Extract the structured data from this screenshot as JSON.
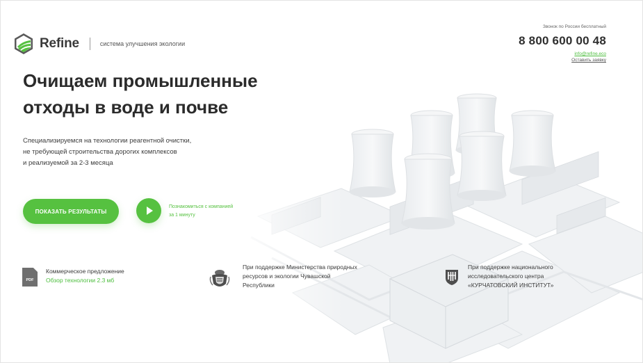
{
  "header": {
    "brand": "Refine",
    "tagline": "система улучшения экологии",
    "contacts": {
      "free_call_label": "Звонок по России бесплатный",
      "phone": "8 800 600 00 48",
      "email": "info@refine.eco",
      "request_link": "Оставить заявку"
    }
  },
  "hero": {
    "title_line1": "Очищаем промышленные",
    "title_line2": "отходы в воде и почве",
    "desc_line1": "Специализируемся на технологии реагентной очистки,",
    "desc_line2": "не требующей строительства дорогих комплексов",
    "desc_line3": "и реализуемой за 2-3 месяца",
    "cta_label": "ПОКАЗАТЬ РЕЗУЛЬТАТЫ",
    "video_line1": "Познакомиться с компанией",
    "video_line2": "за 1 минуту"
  },
  "features": {
    "pdf_badge": "PDF",
    "pdf_title": "Коммерческое предложение",
    "pdf_link": "Обзор технологии 2.3 мб",
    "support1_line1": "При поддержке Министерства природных",
    "support1_line2": "ресурсов и экологии Чувашской",
    "support1_line3": "Республики",
    "support2_line1": "При поддержке национального",
    "support2_line2": "исследовательского центра",
    "support2_line3": "«КУРЧАТОВСКИЙ ИНСТИТУТ»"
  },
  "icons": {
    "logo": "refine-logo-icon",
    "play": "play-icon",
    "pdf": "pdf-file-icon",
    "emblem1": "chuvashia-emblem-icon",
    "emblem2": "kurchatov-institute-icon"
  },
  "colors": {
    "accent": "#56c140",
    "text": "#2b2b2b",
    "muted": "#666666"
  }
}
